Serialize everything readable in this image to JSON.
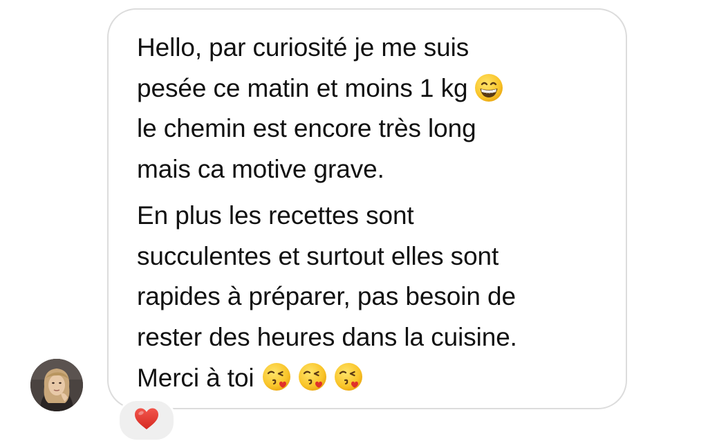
{
  "message": {
    "paragraphs": [
      {
        "lines": [
          "Hello, par curiosité je me suis",
          "pesée ce matin et moins 1 kg",
          "le chemin est encore très long",
          "mais ca motive grave."
        ]
      },
      {
        "lines": [
          "En plus les recettes sont",
          "succulentes et surtout elles sont",
          "rapides à préparer, pas besoin de",
          "rester des heures dans la cuisine.",
          "Merci à toi"
        ]
      }
    ],
    "emojis": {
      "after_weight": "grinning-face-with-smiling-eyes-icon",
      "closing": [
        "face-blowing-kiss-icon",
        "face-blowing-kiss-icon",
        "face-blowing-kiss-icon"
      ]
    }
  },
  "sender": {
    "avatar": "profile-photo"
  },
  "reaction": {
    "icon": "red-heart-icon",
    "color": "#e0312b"
  },
  "colors": {
    "bubble_border": "#dcdcdc",
    "text": "#111111",
    "reaction_bg": "#efefef"
  }
}
